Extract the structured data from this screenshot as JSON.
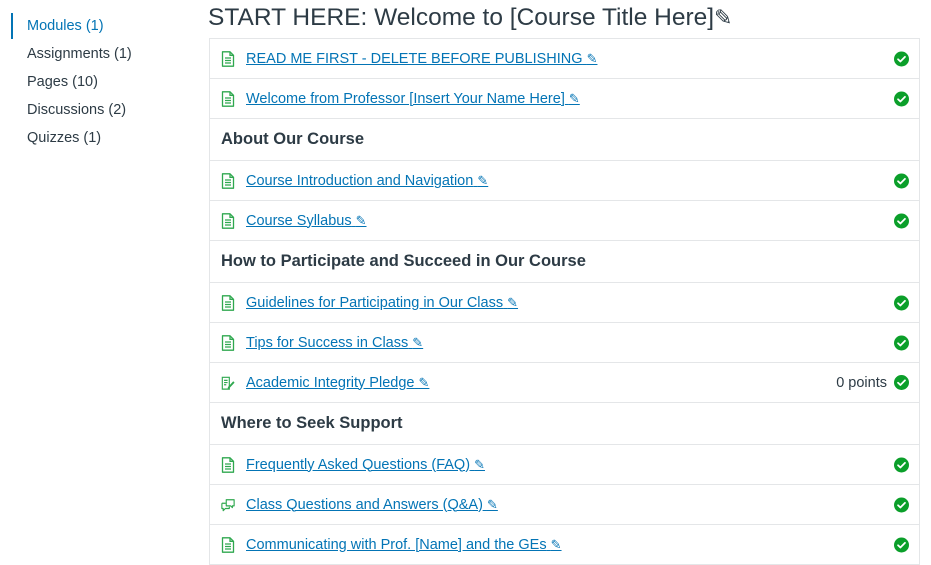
{
  "sidebar": {
    "items": [
      {
        "label": "Modules (1)"
      },
      {
        "label": "Assignments (1)"
      },
      {
        "label": "Pages (10)"
      },
      {
        "label": "Discussions (2)"
      },
      {
        "label": "Quizzes (1)"
      }
    ]
  },
  "module": {
    "title": "START HERE: Welcome to [Course Title Here]",
    "title_edit_glyph": "✎",
    "rows": [
      {
        "kind": "item",
        "icon": "page-icon",
        "label": "READ ME FIRST - DELETE BEFORE PUBLISHING",
        "edit_glyph": "✎",
        "points": "",
        "status": "complete-check-icon"
      },
      {
        "kind": "item",
        "icon": "page-icon",
        "label": "Welcome from Professor [Insert Your Name Here]",
        "edit_glyph": "✎",
        "points": "",
        "status": "complete-check-icon"
      },
      {
        "kind": "header",
        "label": "About Our Course"
      },
      {
        "kind": "item",
        "icon": "page-icon",
        "label": "Course Introduction and Navigation",
        "edit_glyph": "✎",
        "points": "",
        "status": "complete-check-icon"
      },
      {
        "kind": "item",
        "icon": "page-icon",
        "label": "Course Syllabus",
        "edit_glyph": "✎",
        "points": "",
        "status": "complete-check-icon"
      },
      {
        "kind": "header",
        "label": "How to Participate and Succeed in Our Course"
      },
      {
        "kind": "item",
        "icon": "page-icon",
        "label": "Guidelines for Participating in Our Class",
        "edit_glyph": "✎",
        "points": "",
        "status": "complete-check-icon"
      },
      {
        "kind": "item",
        "icon": "page-icon",
        "label": "Tips for Success in Class",
        "edit_glyph": "✎",
        "points": "",
        "status": "complete-check-icon"
      },
      {
        "kind": "item",
        "icon": "assignment-icon",
        "label": "Academic Integrity Pledge",
        "edit_glyph": "✎",
        "points": "0 points",
        "status": "complete-check-icon"
      },
      {
        "kind": "header",
        "label": "Where to Seek Support"
      },
      {
        "kind": "item",
        "icon": "page-icon",
        "label": "Frequently Asked Questions (FAQ)",
        "edit_glyph": "✎",
        "points": "",
        "status": "complete-check-icon"
      },
      {
        "kind": "item",
        "icon": "discussion-icon",
        "label": "Class Questions and Answers (Q&A)",
        "edit_glyph": "✎",
        "points": "",
        "status": "complete-check-icon"
      },
      {
        "kind": "item",
        "icon": "page-icon",
        "label": "Communicating with Prof. [Name] and the GEs",
        "edit_glyph": "✎",
        "points": "",
        "status": "complete-check-icon"
      }
    ]
  },
  "colors": {
    "link": "#0374b5",
    "text": "#2d3b45",
    "icon_green": "#2fa84f",
    "check_green": "#0b9f2a",
    "border": "#e4e6e8"
  }
}
